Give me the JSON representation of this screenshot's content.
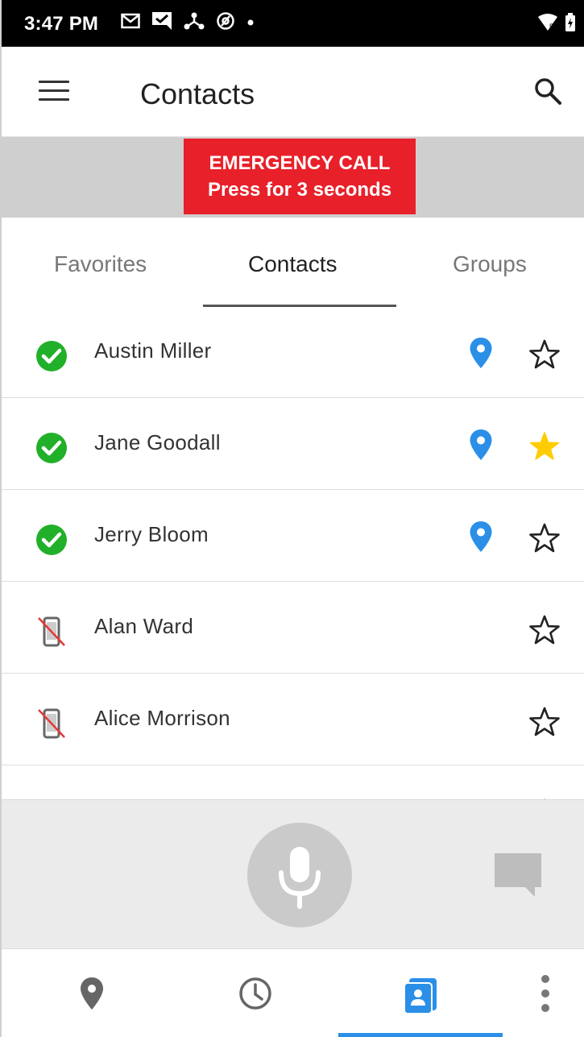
{
  "status_bar": {
    "time": "3:47 PM",
    "left_icons": [
      "gmail-icon",
      "message-check-icon",
      "network-icon",
      "at-sign-icon",
      "dot-icon"
    ],
    "right_icons": [
      "wifi-icon",
      "battery-icon"
    ]
  },
  "app_bar": {
    "title": "Contacts",
    "menu_icon": "hamburger-menu-icon",
    "search_icon": "search-icon"
  },
  "emergency": {
    "line1": "EMERGENCY CALL",
    "line2": "Press for 3 seconds",
    "color": "#e8202a"
  },
  "tabs": [
    {
      "label": "Favorites",
      "active": false
    },
    {
      "label": "Contacts",
      "active": true
    },
    {
      "label": "Groups",
      "active": false
    }
  ],
  "contacts": [
    {
      "name": "Austin Miller",
      "status": "online",
      "location": true,
      "favorite": false
    },
    {
      "name": "Jane Goodall",
      "status": "online",
      "location": true,
      "favorite": true
    },
    {
      "name": "Jerry Bloom",
      "status": "online",
      "location": true,
      "favorite": false
    },
    {
      "name": "Alan Ward",
      "status": "offline",
      "location": false,
      "favorite": false
    },
    {
      "name": "Alice Morrison",
      "status": "offline",
      "location": false,
      "favorite": false
    }
  ],
  "controls": {
    "mic_icon": "microphone-icon",
    "chat_icon": "chat-bubble-icon"
  },
  "bottom_nav": [
    {
      "icon": "map-pin-icon",
      "active": false
    },
    {
      "icon": "clock-icon",
      "active": false
    },
    {
      "icon": "contacts-book-icon",
      "active": true
    },
    {
      "icon": "more-vert-icon",
      "active": false
    }
  ],
  "colors": {
    "online": "#21b02a",
    "location": "#2b8fe8",
    "favorite": "#ffcc00",
    "accent": "#2b8fe8"
  }
}
